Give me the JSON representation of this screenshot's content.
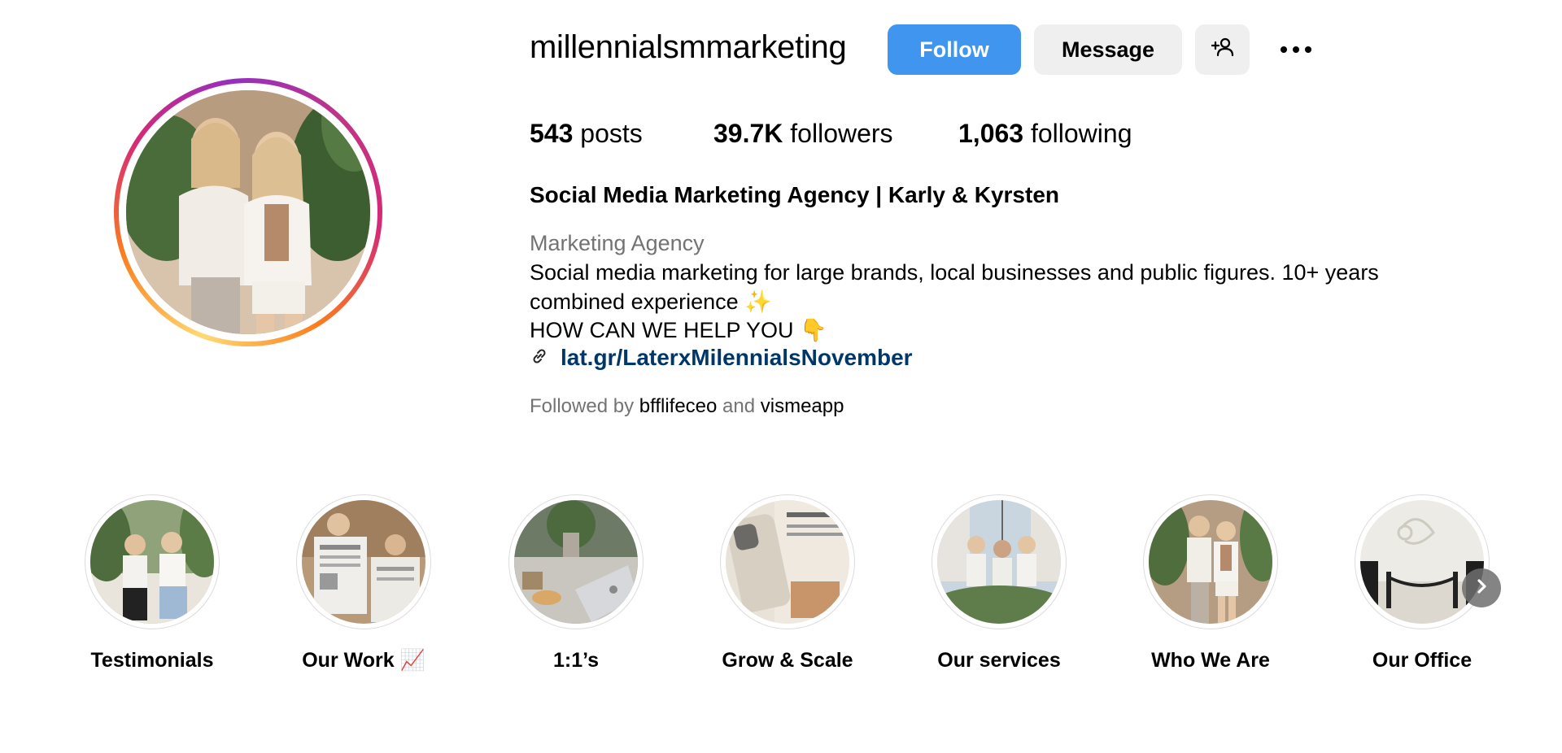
{
  "profile": {
    "username": "millennialsmmarketing",
    "buttons": {
      "follow": "Follow",
      "message": "Message",
      "add_user_icon": "person-add-icon",
      "more_icon": "more-horizontal-icon"
    },
    "stats": {
      "posts_count": "543",
      "posts_label": "posts",
      "followers_count": "39.7K",
      "followers_label": "followers",
      "following_count": "1,063",
      "following_label": "following"
    },
    "full_name": "Social Media Marketing Agency | Karly & Kyrsten",
    "category": "Marketing Agency",
    "bio_lines": [
      "Social media marketing for large brands, local businesses and public figures. 10+ years",
      "combined experience ✨",
      "HOW CAN WE HELP YOU 👇"
    ],
    "link_icon": "link-icon",
    "link": "lat.gr/LaterxMilennialsNovember",
    "followed_by": {
      "prefix": "Followed by",
      "user1": "bfflifeceo",
      "conj": "and",
      "user2": "vismeapp"
    }
  },
  "highlights": [
    {
      "label": "Testimonials"
    },
    {
      "label": "Our Work 📈"
    },
    {
      "label": "1:1’s"
    },
    {
      "label": "Grow & Scale"
    },
    {
      "label": "Our services"
    },
    {
      "label": "Who We Are"
    },
    {
      "label": "Our Office"
    }
  ],
  "colors": {
    "follow_button": "#4096ef",
    "secondary_button": "#efefef",
    "link": "#00376b",
    "muted_text": "#737373"
  },
  "next_icon": "chevron-right-icon"
}
